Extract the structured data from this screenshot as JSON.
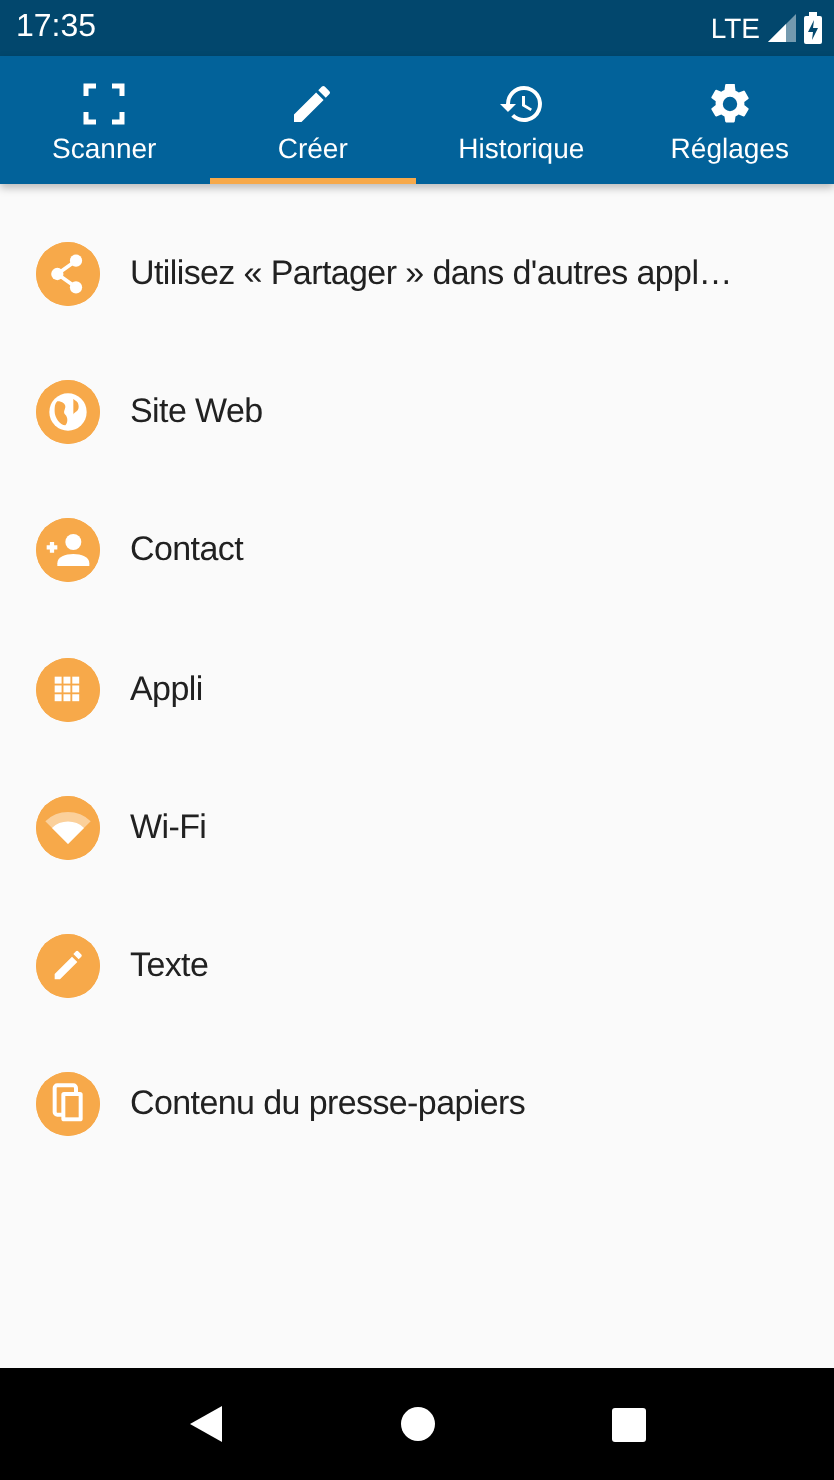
{
  "status_bar": {
    "time": "17:35",
    "network": "LTE"
  },
  "tabs": [
    {
      "label": "Scanner",
      "selected": false
    },
    {
      "label": "Créer",
      "selected": true
    },
    {
      "label": "Historique",
      "selected": false
    },
    {
      "label": "Réglages",
      "selected": false
    }
  ],
  "items": [
    {
      "label": "Utilisez « Partager » dans d'autres appl…"
    },
    {
      "label": "Site Web"
    },
    {
      "label": "Contact"
    },
    {
      "label": "Appli"
    },
    {
      "label": "Wi-Fi"
    },
    {
      "label": "Texte"
    },
    {
      "label": "Contenu du presse-papiers"
    }
  ]
}
